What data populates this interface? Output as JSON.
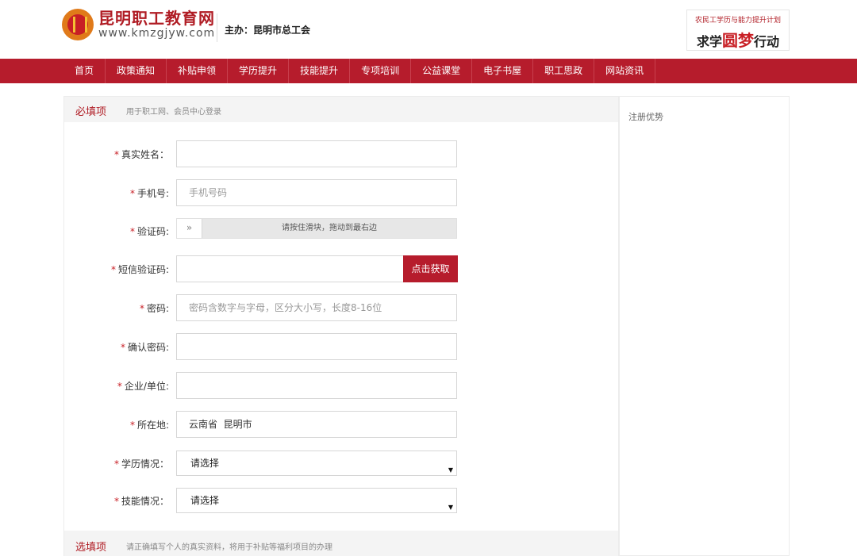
{
  "header": {
    "site_name": "昆明职工教育网",
    "site_url": "www.kmzgjyw.com",
    "host_label": "主办：昆明市总工会",
    "banner_top": "农民工学历与能力提升计划",
    "banner_main_pre": "求学",
    "banner_main_mid": "圆梦",
    "banner_main_post": "行动"
  },
  "nav": {
    "items": [
      {
        "label": "首页"
      },
      {
        "label": "政策通知"
      },
      {
        "label": "补贴申领"
      },
      {
        "label": "学历提升"
      },
      {
        "label": "技能提升"
      },
      {
        "label": "专项培训"
      },
      {
        "label": "公益课堂"
      },
      {
        "label": "电子书屋"
      },
      {
        "label": "职工思政"
      },
      {
        "label": "网站资讯"
      }
    ]
  },
  "required_section": {
    "title": "必填项",
    "description": "用于职工网、会员中心登录"
  },
  "form": {
    "star": "*",
    "real_name": {
      "label": "真实姓名：",
      "value": ""
    },
    "phone": {
      "label": "手机号:",
      "placeholder": "手机号码"
    },
    "captcha": {
      "label": "验证码:",
      "handle_glyph": "»",
      "hint": "请按住滑块，拖动到最右边"
    },
    "sms_code": {
      "label": "短信验证码:",
      "value": "",
      "button": "点击获取"
    },
    "password": {
      "label": "密码:",
      "placeholder": "密码含数字与字母，区分大小写，长度8-16位"
    },
    "confirm_password": {
      "label": "确认密码:",
      "value": ""
    },
    "company": {
      "label": "企业/单位:",
      "value": ""
    },
    "location": {
      "label": "所在地:",
      "value": "云南省  昆明市"
    },
    "education": {
      "label": "学历情况：",
      "selected": "请选择"
    },
    "skill": {
      "label": "技能情况：",
      "selected": "请选择"
    }
  },
  "optional_section": {
    "title": "选填项",
    "description": "请正确填写个人的真实资料，将用于补贴等福利项目的办理"
  },
  "side": {
    "title": "注册优势"
  },
  "colors": {
    "brand_red": "#b61c2c",
    "star_red": "#c81f25"
  }
}
